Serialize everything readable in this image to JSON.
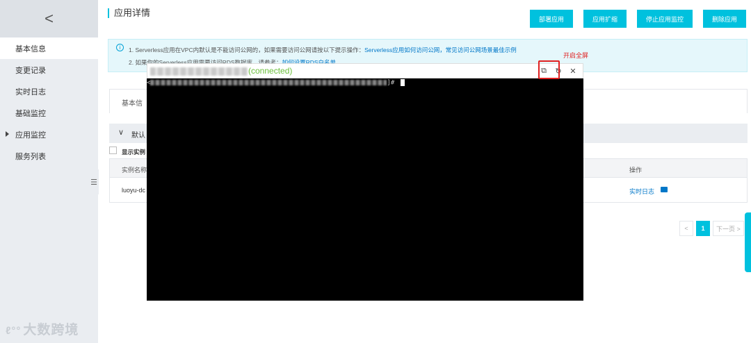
{
  "sidebar": {
    "back_label": "<",
    "items": [
      {
        "label": "基本信息",
        "active": true
      },
      {
        "label": "变更记录"
      },
      {
        "label": "实时日志"
      },
      {
        "label": "基础监控"
      },
      {
        "label": "应用监控",
        "expandable": true
      },
      {
        "label": "服务列表"
      }
    ],
    "collapse_label": "☰"
  },
  "watermark": {
    "mark": "ℓ°°",
    "text": "大数跨境"
  },
  "header": {
    "title": "应用详情"
  },
  "actions": {
    "deploy": "部署应用",
    "scale": "应用扩缩",
    "stop": "停止应用监控",
    "delete": "删除应用"
  },
  "notice": {
    "icon": "i",
    "line1_text": "1. Serverless应用在VPC内默认是不能访问公网的，如果需要访问公网请按以下提示操作：",
    "line1_link1": "Serverless应用如何访问公网，",
    "line1_link2": "常见访问公网场景最佳示例",
    "line2_text": "2. 如果你的Serverless应用需要访问RDS数据库，请参考：",
    "line2_link": "如何设置RDS白名单"
  },
  "annotation": {
    "text": "开启全屏"
  },
  "tabs": {
    "basic": "基本信"
  },
  "section": {
    "arrow": "∨",
    "title": "默认"
  },
  "checkbox": {
    "label": "显示实例"
  },
  "table": {
    "col_name": "实例名称",
    "col_op": "操作",
    "rows": [
      {
        "name": "luoyu-dc",
        "op_link": "实时日志"
      }
    ]
  },
  "pagination": {
    "prev": "<",
    "current": "1",
    "next": "下一页 >"
  },
  "terminal": {
    "status": "(connected)",
    "prompt_open": "<",
    "prompt_close": "]# ",
    "fullscreen_icon": "⧉",
    "refresh_icon": "↻",
    "close_icon": "✕"
  },
  "colors": {
    "accent": "#00c1de",
    "link": "#0077c8",
    "annotation": "#e02020",
    "connected": "#6abf3a"
  }
}
